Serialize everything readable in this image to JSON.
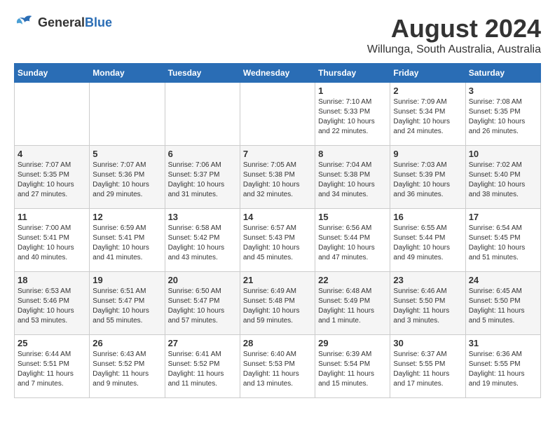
{
  "header": {
    "logo_general": "General",
    "logo_blue": "Blue",
    "month_year": "August 2024",
    "location": "Willunga, South Australia, Australia"
  },
  "weekdays": [
    "Sunday",
    "Monday",
    "Tuesday",
    "Wednesday",
    "Thursday",
    "Friday",
    "Saturday"
  ],
  "weeks": [
    [
      {
        "day": "",
        "info": ""
      },
      {
        "day": "",
        "info": ""
      },
      {
        "day": "",
        "info": ""
      },
      {
        "day": "",
        "info": ""
      },
      {
        "day": "1",
        "info": "Sunrise: 7:10 AM\nSunset: 5:33 PM\nDaylight: 10 hours\nand 22 minutes."
      },
      {
        "day": "2",
        "info": "Sunrise: 7:09 AM\nSunset: 5:34 PM\nDaylight: 10 hours\nand 24 minutes."
      },
      {
        "day": "3",
        "info": "Sunrise: 7:08 AM\nSunset: 5:35 PM\nDaylight: 10 hours\nand 26 minutes."
      }
    ],
    [
      {
        "day": "4",
        "info": "Sunrise: 7:07 AM\nSunset: 5:35 PM\nDaylight: 10 hours\nand 27 minutes."
      },
      {
        "day": "5",
        "info": "Sunrise: 7:07 AM\nSunset: 5:36 PM\nDaylight: 10 hours\nand 29 minutes."
      },
      {
        "day": "6",
        "info": "Sunrise: 7:06 AM\nSunset: 5:37 PM\nDaylight: 10 hours\nand 31 minutes."
      },
      {
        "day": "7",
        "info": "Sunrise: 7:05 AM\nSunset: 5:38 PM\nDaylight: 10 hours\nand 32 minutes."
      },
      {
        "day": "8",
        "info": "Sunrise: 7:04 AM\nSunset: 5:38 PM\nDaylight: 10 hours\nand 34 minutes."
      },
      {
        "day": "9",
        "info": "Sunrise: 7:03 AM\nSunset: 5:39 PM\nDaylight: 10 hours\nand 36 minutes."
      },
      {
        "day": "10",
        "info": "Sunrise: 7:02 AM\nSunset: 5:40 PM\nDaylight: 10 hours\nand 38 minutes."
      }
    ],
    [
      {
        "day": "11",
        "info": "Sunrise: 7:00 AM\nSunset: 5:41 PM\nDaylight: 10 hours\nand 40 minutes."
      },
      {
        "day": "12",
        "info": "Sunrise: 6:59 AM\nSunset: 5:41 PM\nDaylight: 10 hours\nand 41 minutes."
      },
      {
        "day": "13",
        "info": "Sunrise: 6:58 AM\nSunset: 5:42 PM\nDaylight: 10 hours\nand 43 minutes."
      },
      {
        "day": "14",
        "info": "Sunrise: 6:57 AM\nSunset: 5:43 PM\nDaylight: 10 hours\nand 45 minutes."
      },
      {
        "day": "15",
        "info": "Sunrise: 6:56 AM\nSunset: 5:44 PM\nDaylight: 10 hours\nand 47 minutes."
      },
      {
        "day": "16",
        "info": "Sunrise: 6:55 AM\nSunset: 5:44 PM\nDaylight: 10 hours\nand 49 minutes."
      },
      {
        "day": "17",
        "info": "Sunrise: 6:54 AM\nSunset: 5:45 PM\nDaylight: 10 hours\nand 51 minutes."
      }
    ],
    [
      {
        "day": "18",
        "info": "Sunrise: 6:53 AM\nSunset: 5:46 PM\nDaylight: 10 hours\nand 53 minutes."
      },
      {
        "day": "19",
        "info": "Sunrise: 6:51 AM\nSunset: 5:47 PM\nDaylight: 10 hours\nand 55 minutes."
      },
      {
        "day": "20",
        "info": "Sunrise: 6:50 AM\nSunset: 5:47 PM\nDaylight: 10 hours\nand 57 minutes."
      },
      {
        "day": "21",
        "info": "Sunrise: 6:49 AM\nSunset: 5:48 PM\nDaylight: 10 hours\nand 59 minutes."
      },
      {
        "day": "22",
        "info": "Sunrise: 6:48 AM\nSunset: 5:49 PM\nDaylight: 11 hours\nand 1 minute."
      },
      {
        "day": "23",
        "info": "Sunrise: 6:46 AM\nSunset: 5:50 PM\nDaylight: 11 hours\nand 3 minutes."
      },
      {
        "day": "24",
        "info": "Sunrise: 6:45 AM\nSunset: 5:50 PM\nDaylight: 11 hours\nand 5 minutes."
      }
    ],
    [
      {
        "day": "25",
        "info": "Sunrise: 6:44 AM\nSunset: 5:51 PM\nDaylight: 11 hours\nand 7 minutes."
      },
      {
        "day": "26",
        "info": "Sunrise: 6:43 AM\nSunset: 5:52 PM\nDaylight: 11 hours\nand 9 minutes."
      },
      {
        "day": "27",
        "info": "Sunrise: 6:41 AM\nSunset: 5:52 PM\nDaylight: 11 hours\nand 11 minutes."
      },
      {
        "day": "28",
        "info": "Sunrise: 6:40 AM\nSunset: 5:53 PM\nDaylight: 11 hours\nand 13 minutes."
      },
      {
        "day": "29",
        "info": "Sunrise: 6:39 AM\nSunset: 5:54 PM\nDaylight: 11 hours\nand 15 minutes."
      },
      {
        "day": "30",
        "info": "Sunrise: 6:37 AM\nSunset: 5:55 PM\nDaylight: 11 hours\nand 17 minutes."
      },
      {
        "day": "31",
        "info": "Sunrise: 6:36 AM\nSunset: 5:55 PM\nDaylight: 11 hours\nand 19 minutes."
      }
    ]
  ]
}
